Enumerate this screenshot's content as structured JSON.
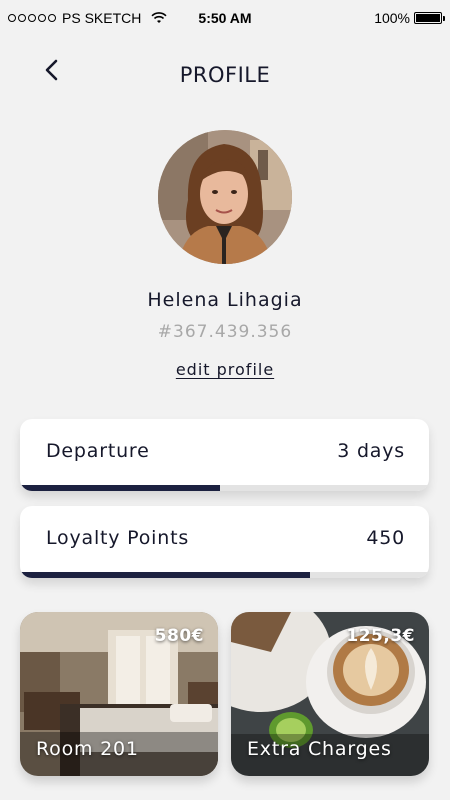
{
  "status_bar": {
    "carrier": "PS SKETCH",
    "time": "5:50 AM",
    "battery": "100%"
  },
  "header": {
    "title": "PROFILE",
    "back_icon": "chevron-left-icon"
  },
  "profile": {
    "name": "Helena Lihagia",
    "member_id": "#367.439.356",
    "edit_label": "edit profile"
  },
  "stats": [
    {
      "label": "Departure",
      "value": "3 days",
      "progress": 0.49
    },
    {
      "label": "Loyalty Points",
      "value": "450",
      "progress": 0.71
    }
  ],
  "tiles": [
    {
      "label": "Room 201",
      "price": "580€"
    },
    {
      "label": "Extra Charges",
      "price": "125,3€"
    }
  ],
  "colors": {
    "background": "#f2f2f2",
    "text": "#16182b",
    "accent": "#1c2140",
    "muted": "#a8a8a8"
  }
}
